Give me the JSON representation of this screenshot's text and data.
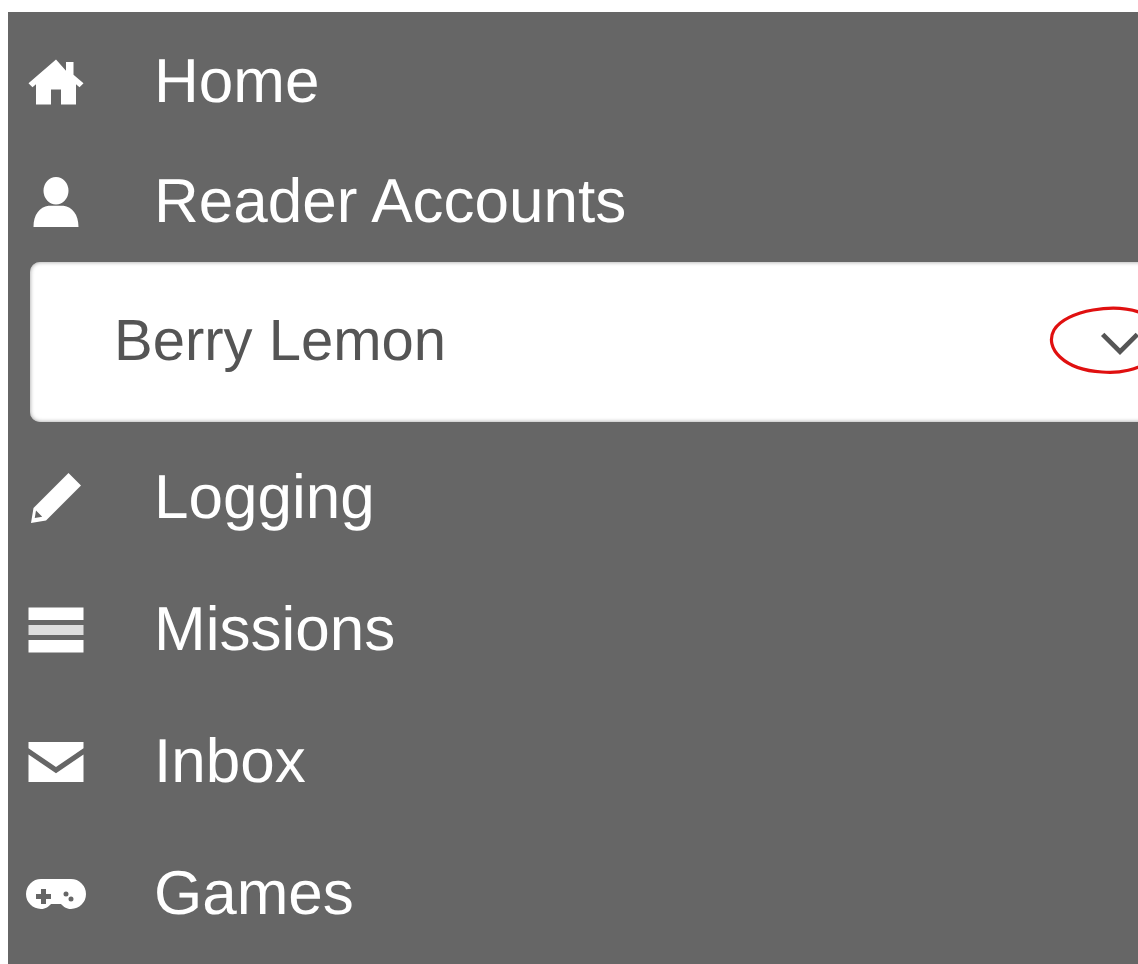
{
  "sidebar": {
    "items": [
      {
        "kind": "link",
        "label": "Home"
      },
      {
        "kind": "link",
        "label": "Reader Accounts"
      },
      {
        "kind": "select",
        "value": "Berry Lemon",
        "annotated": true
      },
      {
        "kind": "link",
        "label": "Logging"
      },
      {
        "kind": "link",
        "label": "Missions"
      },
      {
        "kind": "link",
        "label": "Inbox"
      },
      {
        "kind": "link",
        "label": "Games"
      }
    ]
  }
}
